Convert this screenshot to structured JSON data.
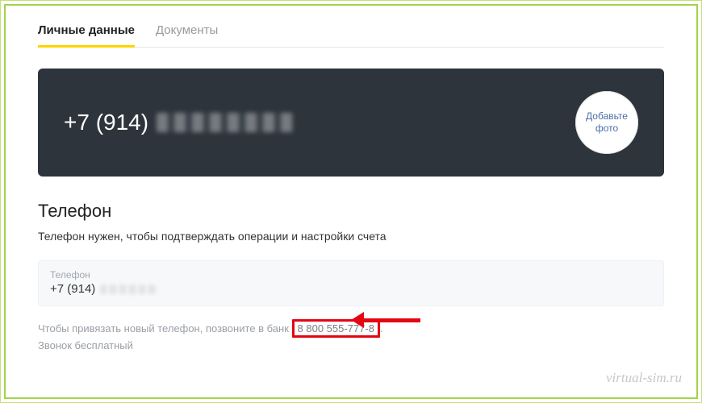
{
  "tabs": {
    "personal": "Личные данные",
    "documents": "Документы"
  },
  "header": {
    "phone_prefix": "+7 (914)",
    "avatar_label": "Добавьте фото"
  },
  "section": {
    "title": "Телефон",
    "description": "Телефон нужен, чтобы подтверждать операции и настройки счета",
    "field_label": "Телефон",
    "field_value_prefix": "+7 (914)"
  },
  "hint": {
    "line1_prefix": "Чтобы привязать новый телефон, позвоните в банк",
    "highlight_number": "8 800 555-777-8",
    "line2": "Звонок бесплатный"
  },
  "watermark": "virtual-sim.ru"
}
